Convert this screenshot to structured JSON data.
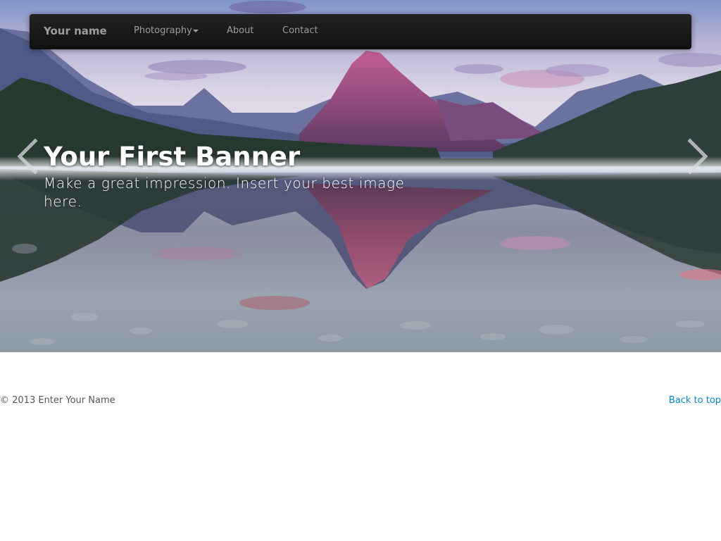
{
  "navbar": {
    "brand": "Your name",
    "items": [
      {
        "label": "Photography",
        "has_dropdown": true
      },
      {
        "label": "About"
      },
      {
        "label": "Contact"
      }
    ],
    "background": "#1a1a1a",
    "text_color": "#9d9d9d"
  },
  "carousel": {
    "title": "Your First Banner",
    "text": "Make a great impression. Insert your best image here.",
    "prev_icon": "chevron-left-icon",
    "next_icon": "chevron-right-icon"
  },
  "footer": {
    "copyright": "© 2013 Enter Your Name",
    "back_to_top": "Back to top",
    "link_color": "#0088cc"
  }
}
